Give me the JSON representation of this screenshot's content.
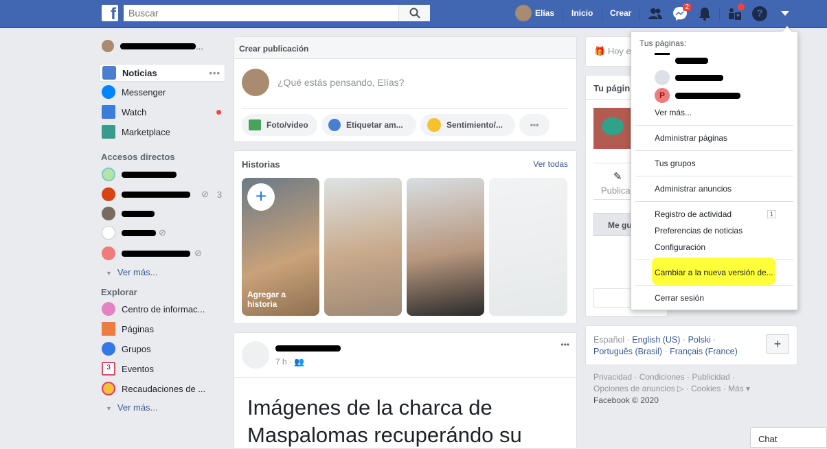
{
  "header": {
    "logo": "f",
    "search_placeholder": "Buscar",
    "user": "Elías",
    "home": "Inicio",
    "create": "Crear",
    "messenger_badge": "2",
    "brand_color": "#4267b2"
  },
  "sidebar": {
    "items": [
      {
        "label": "Noticias",
        "icon": "news-feed-icon"
      },
      {
        "label": "Messenger",
        "icon": "messenger-icon"
      },
      {
        "label": "Watch",
        "icon": "watch-icon"
      },
      {
        "label": "Marketplace",
        "icon": "marketplace-icon"
      }
    ],
    "shortcuts_title": "Accesos directos",
    "shortcut_count": "3",
    "see_more": "Ver más...",
    "explore_title": "Explorar",
    "explore": [
      {
        "label": "Centro de informac..."
      },
      {
        "label": "Páginas"
      },
      {
        "label": "Grupos"
      },
      {
        "label": "Eventos"
      },
      {
        "label": "Recaudaciones de ..."
      }
    ],
    "see_more2": "Ver más..."
  },
  "composer": {
    "title": "Crear publicación",
    "placeholder": "¿Qué estás pensando, Elías?",
    "actions": [
      "Foto/video",
      "Etiquetar am...",
      "Sentimiento/..."
    ]
  },
  "stories": {
    "title": "Historias",
    "see_all": "Ver todas",
    "add": "Agregar a historia"
  },
  "post": {
    "time": "7 h ·",
    "text": "Imágenes de la charca de Maspalomas recuperándo su"
  },
  "right": {
    "birthday": "Hoy e",
    "pages_title": "Tu págin",
    "publish": "Publica",
    "like": "Me gu"
  },
  "languages": {
    "current": "Español ·",
    "others": [
      "English (US)",
      "Polski",
      "Português (Brasil)",
      "Français (France)"
    ]
  },
  "footer": {
    "line1": "Privacidad · Condiciones · Publicidad ·",
    "line2": "Opciones de anuncios ▷ · Cookies · Más ▾",
    "copyright": "Facebook © 2020"
  },
  "chat": "Chat",
  "dropdown": {
    "pages_label": "Tus páginas:",
    "see_more": "Ver más...",
    "items": [
      "Administrar páginas",
      "Tus grupos",
      "Administrar anuncios"
    ],
    "activity": "Registro de actividad",
    "activity_count": "1",
    "prefs": "Preferencias de noticias",
    "settings": "Configuración",
    "new_version": "Cambiar a la nueva versión de...",
    "logout": "Cerrar sesión",
    "highlight": "#ffff3a"
  }
}
